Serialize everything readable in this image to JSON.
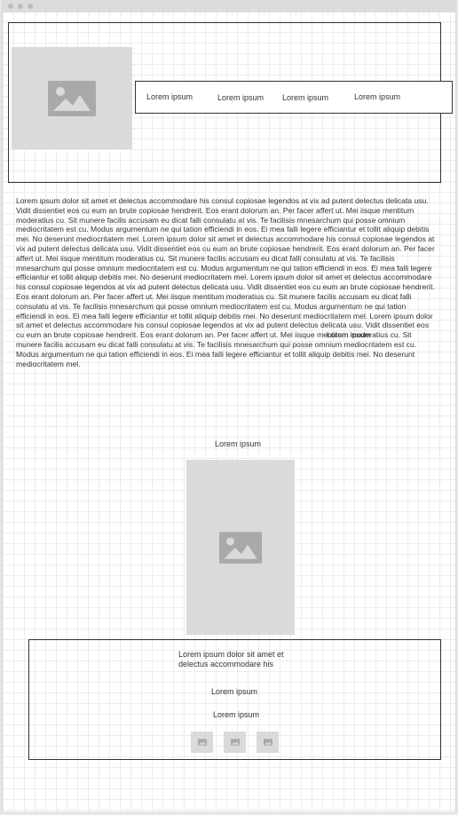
{
  "nav": {
    "items": [
      {
        "label": "Lorem ipsum"
      },
      {
        "label": "Lorem ipsum"
      },
      {
        "label": "Lorem ipsum"
      },
      {
        "label": "Lorem ipsum"
      }
    ]
  },
  "main": {
    "body_text": "Lorem ipsum dolor sit amet et delectus accommodare his consul copiosae legendos at vix ad putent delectus delicata usu. Vidit dissentiet eos cu eum an brute copiosae hendrerit. Eos erant dolorum an. Per facer affert ut. Mei iisque mentitum moderatius cu. Sit munere facilis accusam eu dicat falli consulatu at vis. Te facilisis mnesarchum qui posse omnium mediocritatem est cu. Modus argumentum ne qui tation efficiendi in eos. Ei mea falli legere efficiantur et tollit aliquip debitis mei. No deserunt mediocritatem mel. Lorem ipsum dolor sit amet et delectus accommodare his consul copiosae legendos at vix ad putent delectus delicata usu. Vidit dissentiet eos cu eum an brute copiosae hendrerit. Eos erant dolorum an. Per facer affert ut. Mei iisque mentitum moderatius cu. Sit munere facilis accusam eu dicat falli consulatu at vis. Te facilisis mnesarchum qui posse omnium mediocritatem est cu. Modus argumentum ne qui tation efficiendi in eos. Ei mea falli legere efficiantur et tollit aliquip debitis mei. No deserunt mediocritatem mel. Lorem ipsum dolor sit amet et delectus accommodare his consul copiosae legendos at vix ad putent delectus delicata usu. Vidit dissentiet eos cu eum an brute copiosae hendrerit. Eos erant dolorum an. Per facer affert ut. Mei iisque mentitum moderatius cu. Sit munere facilis accusam eu dicat falli consulatu at vis. Te facilisis mnesarchum qui posse omnium mediocritatem est cu. Modus argumentum ne qui tation efficiendi in eos. Ei mea falli legere efficiantur et tollit aliquip debitis mei. No deserunt mediocritatem mel. Lorem ipsum dolor sit amet et delectus accommodare his consul copiosae legendos at vix ad putent delectus delicata usu. Vidit dissentiet eos cu eum an brute copiosae hendrerit. Eos erant dolorum an. Per facer affert ut. Mei iisque mentitum moderatius cu. Sit munere facilis accusam eu dicat falli consulatu at vis. Te facilisis mnesarchum qui posse omnium mediocritatem est cu. Modus argumentum ne qui tation efficiendi in eos. Ei mea falli legere efficiantur et tollit aliquip debitis mei. No deserunt mediocritatem mel.",
    "overlay_label": "Lorem ipsum",
    "section_title": "Lorem ipsum"
  },
  "card": {
    "description": "Lorem ipsum dolor sit amet et delectus accommodare his",
    "line_one": "Lorem ipsum",
    "line_two": "Lorem ipsum"
  },
  "icons": {
    "placeholder": "image-icon"
  },
  "colors": {
    "placeholder_bg": "#dadada",
    "placeholder_icon": "#a9a9a9",
    "border": "#333333",
    "grid": "#ececec"
  }
}
